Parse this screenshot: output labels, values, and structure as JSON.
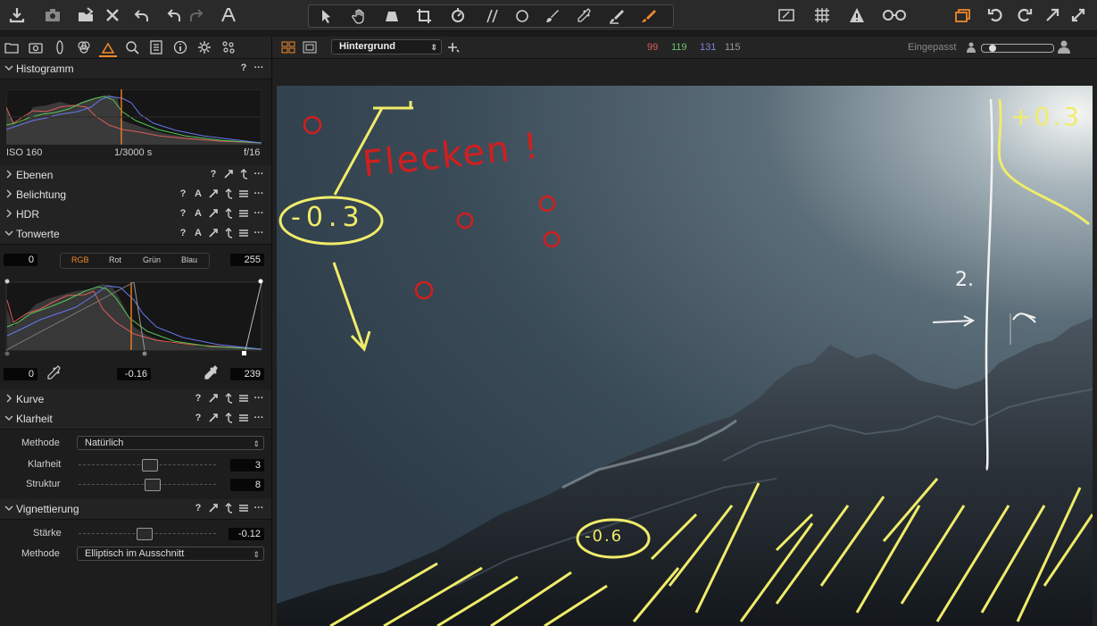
{
  "toolbar": {
    "left_icons": [
      "import-icon",
      "camera-icon",
      "export-icon",
      "delete-icon",
      "undo-all-icon",
      "undo-icon",
      "redo-icon",
      "text-annotation-icon"
    ],
    "tools": [
      "select-icon",
      "pan-icon",
      "keystone-icon",
      "crop-icon",
      "rotate-icon",
      "straighten-icon",
      "circle-icon",
      "brush-icon",
      "picker-icon",
      "eraser-icon",
      "annotate-pen-icon"
    ],
    "right_icons": [
      "edit-mask-icon",
      "grid-icon",
      "warning-icon",
      "loupe-icon",
      "variants-icon",
      "rotate-left-icon",
      "rotate-right-icon",
      "fullscreen-icon",
      "settings-icon"
    ],
    "accent": "#f0892a"
  },
  "tool_tabs": [
    "library-tab",
    "capture-tab",
    "lens-tab",
    "color-tab",
    "exposure-tab",
    "details-tab",
    "metadata-tab",
    "info-tab",
    "adjustments-tab",
    "styles-tab"
  ],
  "histogram_panel": {
    "title": "Histogramm",
    "iso": "ISO 160",
    "shutter": "1/3000 s",
    "aperture": "f/16"
  },
  "sections": {
    "ebenen": "Ebenen",
    "belichtung": "Belichtung",
    "hdr": "HDR",
    "tonwerte": "Tonwerte",
    "kurve": "Kurve",
    "klarheit": "Klarheit",
    "vignettierung": "Vignettierung"
  },
  "levels": {
    "input_low": "0",
    "input_high": "255",
    "channels": [
      "RGB",
      "Rot",
      "Grün",
      "Blau"
    ],
    "active_channel": "RGB",
    "output_low": "0",
    "midtone": "-0.16",
    "output_high": "239"
  },
  "clarity": {
    "method_label": "Methode",
    "method_value": "Natürlich",
    "clarity_label": "Klarheit",
    "clarity_value": "3",
    "structure_label": "Struktur",
    "structure_value": "8"
  },
  "vignette": {
    "amount_label": "Stärke",
    "amount_value": "-0.12",
    "method_label": "Methode",
    "method_value": "Elliptisch im Ausschnitt"
  },
  "viewer": {
    "layer": "Hintergrund",
    "rgb_r": "99",
    "rgb_g": "119",
    "rgb_b": "131",
    "rgb_l": "115",
    "r_color": "#e05a5a",
    "g_color": "#6cc46c",
    "b_color": "#7a86d8",
    "zoom_label": "Eingepasst"
  },
  "annotations": {
    "flecken": "Flecken !",
    "minus03": "-0.3",
    "minus06": "-0.6",
    "plus03": "+0.3",
    "two": "2."
  }
}
